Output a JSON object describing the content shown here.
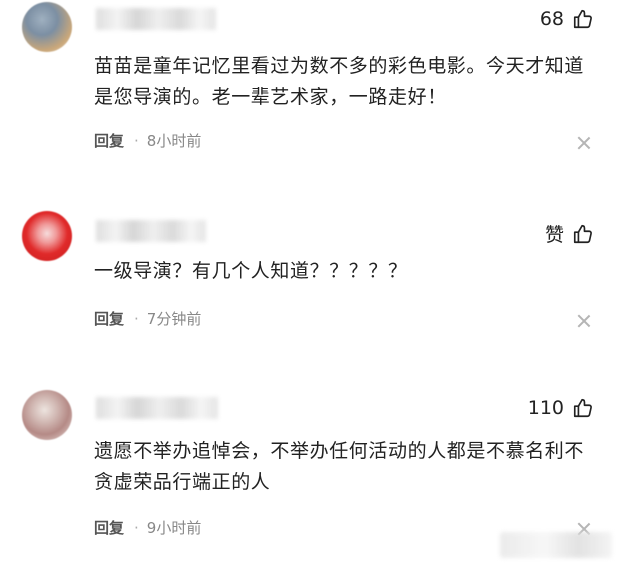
{
  "comments": [
    {
      "likes": "68",
      "content": "苗苗是童年记忆里看过为数不多的彩色电影。今天才知道是您导演的。老一辈艺术家，一路走好！",
      "reply_label": "回复",
      "separator": "·",
      "time": "8小时前",
      "avatar_colors": [
        "#7c8fa3",
        "#c9a77a"
      ]
    },
    {
      "likes": "赞",
      "content": "一级导演？有几个人知道？？？？？",
      "reply_label": "回复",
      "separator": "·",
      "time": "7分钟前",
      "avatar_colors": [
        "#e02a2a",
        "#f6dcdc"
      ]
    },
    {
      "likes": "110",
      "content": "遗愿不举办追悼会，不举办任何活动的人都是不慕名利不贪虚荣品行端正的人",
      "reply_label": "回复",
      "separator": "·",
      "time": "9小时前",
      "avatar_colors": [
        "#b58a86",
        "#ede4df"
      ]
    }
  ],
  "icons": {
    "like": "thumbs-up-icon",
    "close": "close-icon"
  }
}
